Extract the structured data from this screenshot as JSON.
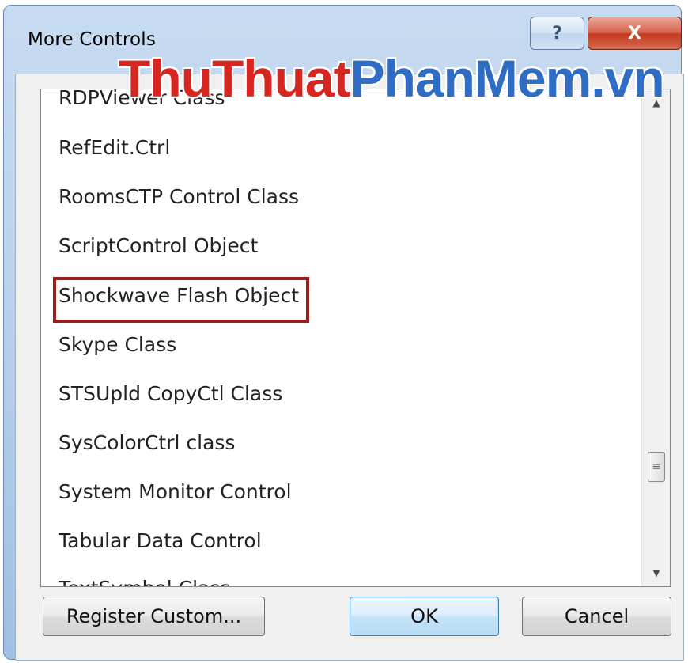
{
  "window": {
    "title": "More Controls",
    "help_label": "?",
    "close_label": "X"
  },
  "list": {
    "items": [
      "RDPViewer Class",
      "RefEdit.Ctrl",
      "RoomsCTP Control Class",
      "ScriptControl Object",
      "Shockwave Flash Object",
      "Skype Class",
      "STSUpld CopyCtl Class",
      "SysColorCtrl class",
      "System Monitor Control",
      "Tabular Data Control",
      "TextSymbol Class"
    ],
    "highlighted_item": "Shockwave Flash Object"
  },
  "scrollbar": {
    "up_icon": "arrow-up-icon",
    "down_icon": "arrow-down-icon",
    "thumb_icon": "grip-icon"
  },
  "buttons": {
    "register": "Register Custom...",
    "ok": "OK",
    "cancel": "Cancel"
  },
  "watermark": {
    "part1": "ThuThuat",
    "part2": "PhanMem.vn",
    "color_part1": "#d6261f",
    "color_part2": "#2f6cc4"
  },
  "colors": {
    "highlight_border": "#9b1c1c",
    "frame": "#b9d1ec",
    "close_button": "#c4391f"
  }
}
